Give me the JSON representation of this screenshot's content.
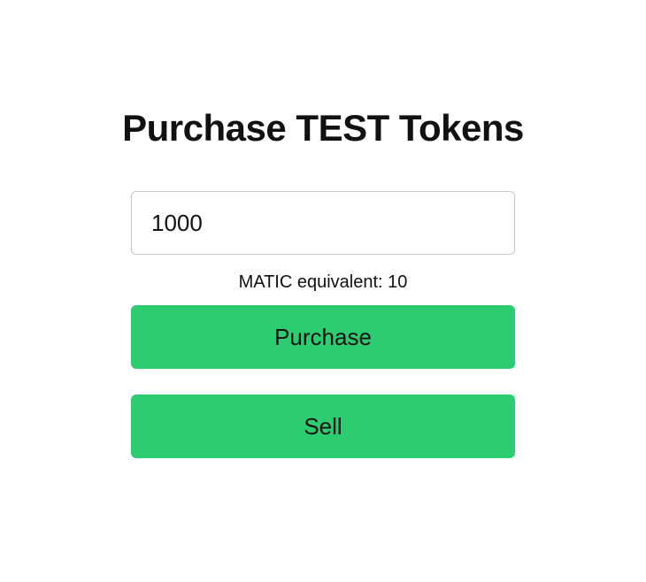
{
  "page": {
    "title": "Purchase TEST Tokens"
  },
  "form": {
    "amount_value": "1000",
    "equivalent_text": "MATIC equivalent: 10",
    "purchase_label": "Purchase",
    "sell_label": "Sell"
  },
  "colors": {
    "button_bg": "#2ecc71",
    "input_border": "#c8c8c8"
  }
}
